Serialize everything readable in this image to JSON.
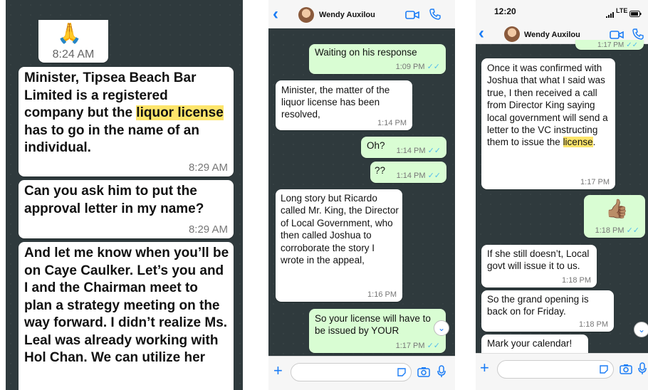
{
  "panel1": {
    "emoji": "🙏",
    "emoji_time": "8:24 AM",
    "msg1": {
      "pre": "Minister, Tipsea Beach Bar Limited is a registered company but the ",
      "highlight": "liquor license",
      "post": " has to go in the name of an individual.",
      "time": "8:29 AM"
    },
    "msg2": {
      "text": "Can you ask him to put the approval letter in my name?",
      "time": "8:29 AM"
    },
    "msg3": {
      "text": "And let me know when you’ll be on Caye Caulker. Let’s you and I and the Chairman meet to plan a strategy meeting on the way forward. I didn’t realize Ms. Leal was already working with Hol Chan. We can utilize her"
    }
  },
  "panel2": {
    "contact": "Wendy Auxilou",
    "messages": [
      {
        "text": "Waiting on his response",
        "time": "1:09 PM"
      },
      {
        "text": "Minister, the matter of the liquor license has been resolved,",
        "time": "1:14 PM"
      },
      {
        "text": "Oh?",
        "time": "1:14 PM"
      },
      {
        "text": "??",
        "time": "1:14 PM"
      },
      {
        "text": "Long story but Ricardo called Mr. King, the Director of Local Government, who then called Joshua to corroborate the story I wrote in the appeal,",
        "time": "1:16 PM"
      },
      {
        "text": "So your license will have to be issued by YOUR",
        "time": "1:17 PM"
      }
    ]
  },
  "panel3": {
    "status_time": "12:20",
    "status_network": "LTE",
    "contact": "Wendy Auxilou",
    "top_time": "1:17 PM",
    "msg1": {
      "pre": "Once it was confirmed with Joshua that what I said was true, I then received a call from Director King saying local government will send a letter to the VC instructing them to issue the ",
      "highlight": "license",
      "post": ".",
      "time": "1:17 PM"
    },
    "thumbs": "👍🏽",
    "thumbs_time": "1:18 PM",
    "msg2": {
      "text": "If she still doesn’t, Local govt will issue it to us.",
      "time": "1:18 PM"
    },
    "msg3": {
      "text": "So the grand opening is back on for Friday.",
      "time": "1:18 PM"
    },
    "msg4": {
      "text": "Mark your calendar!"
    }
  },
  "icons": {
    "ticks": "✓✓",
    "back": "‹",
    "plus": "+",
    "scroll_down": "⌄"
  }
}
